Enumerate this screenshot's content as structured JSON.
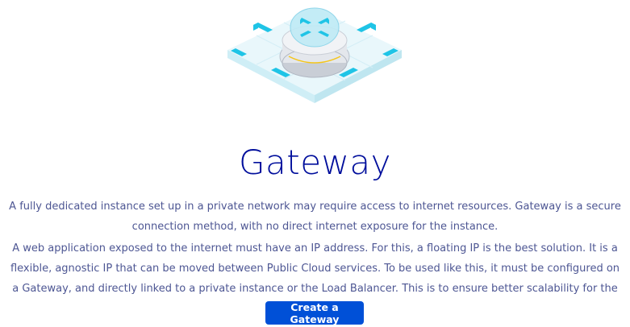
{
  "illustration": {
    "icon": "gateway-router-icon"
  },
  "title": "Gateway",
  "paragraphs": [
    "A fully dedicated instance set up in a private network may require access to internet resources. Gateway is a secure connection method, with no direct internet exposure for the instance.",
    "A web application exposed to the internet must have an IP address. For this, a floating IP is the best solution. It is a flexible, agnostic IP that can be moved between Public Cloud services. To be used like this, it must be configured on a Gateway, and directly linked to a private instance or the Load Balancer. This is to ensure better scalability for the service."
  ],
  "cta": {
    "label": "Create a Gateway"
  },
  "colors": {
    "title": "#000e9c",
    "text": "#4d5693",
    "button": "#0050d7",
    "accent": "#1fc4e6"
  }
}
